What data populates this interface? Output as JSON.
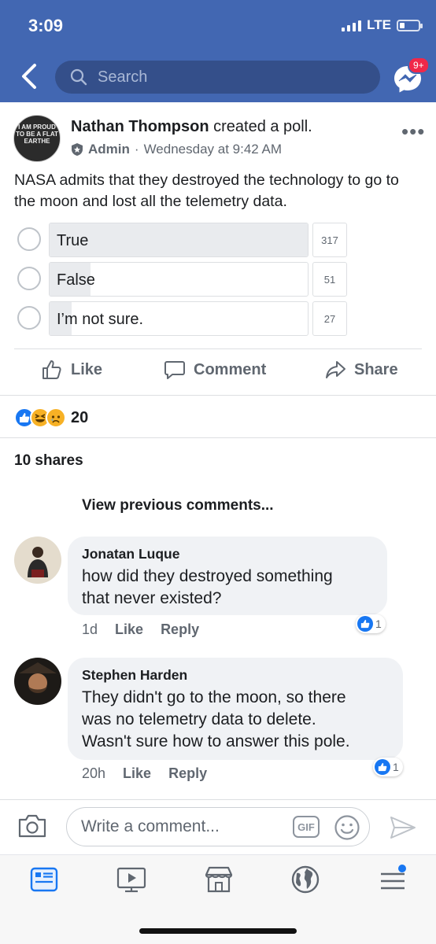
{
  "status": {
    "time": "3:09",
    "network": "LTE"
  },
  "header": {
    "search_placeholder": "Search",
    "messenger_badge": "9+"
  },
  "post": {
    "avatar_text": "I AM PROUD TO BE A FLAT EARTHE",
    "author": "Nathan Thompson",
    "action": " created a poll.",
    "role": "Admin",
    "separator": "·",
    "time": "Wednesday at 9:42 AM",
    "more": "•••",
    "text": "NASA admits that they destroyed the technology to go to the moon and lost all the telemetry data."
  },
  "poll": {
    "options": [
      {
        "label": "True",
        "votes": "317",
        "fill": 1.0
      },
      {
        "label": "False",
        "votes": "51",
        "fill": 0.16
      },
      {
        "label": "I’m not sure.",
        "votes": "27",
        "fill": 0.085
      }
    ]
  },
  "actions": {
    "like": "Like",
    "comment": "Comment",
    "share": "Share"
  },
  "reactions": {
    "count": "20"
  },
  "shares": "10 shares",
  "view_previous": "View previous comments...",
  "comments": [
    {
      "name": "Jonatan Luque",
      "text_1": "how did they destroyed something",
      "text_2": "that never existed?",
      "age": "1d",
      "like": "Like",
      "reply": "Reply",
      "likes": "1"
    },
    {
      "name": "Stephen Harden",
      "text_1": "They didn't go to the moon, so there",
      "text_2": "was no telemetry data to delete.",
      "text_3": "Wasn't sure how to answer this pole.",
      "age": "20h",
      "like": "Like",
      "reply": "Reply",
      "likes": "1"
    }
  ],
  "composer": {
    "placeholder": "Write a comment...",
    "gif": "GIF"
  },
  "colors": {
    "brand": "#4267b2",
    "like_blue": "#1877f2",
    "badge_red": "#f02849"
  },
  "icons": [
    "back-icon",
    "search-icon",
    "messenger-icon",
    "shield-icon",
    "thumbs-up-icon",
    "comment-icon",
    "share-icon",
    "camera-icon",
    "emoji-icon",
    "send-icon",
    "news-feed-icon",
    "watch-icon",
    "marketplace-icon",
    "globe-icon",
    "menu-icon"
  ]
}
